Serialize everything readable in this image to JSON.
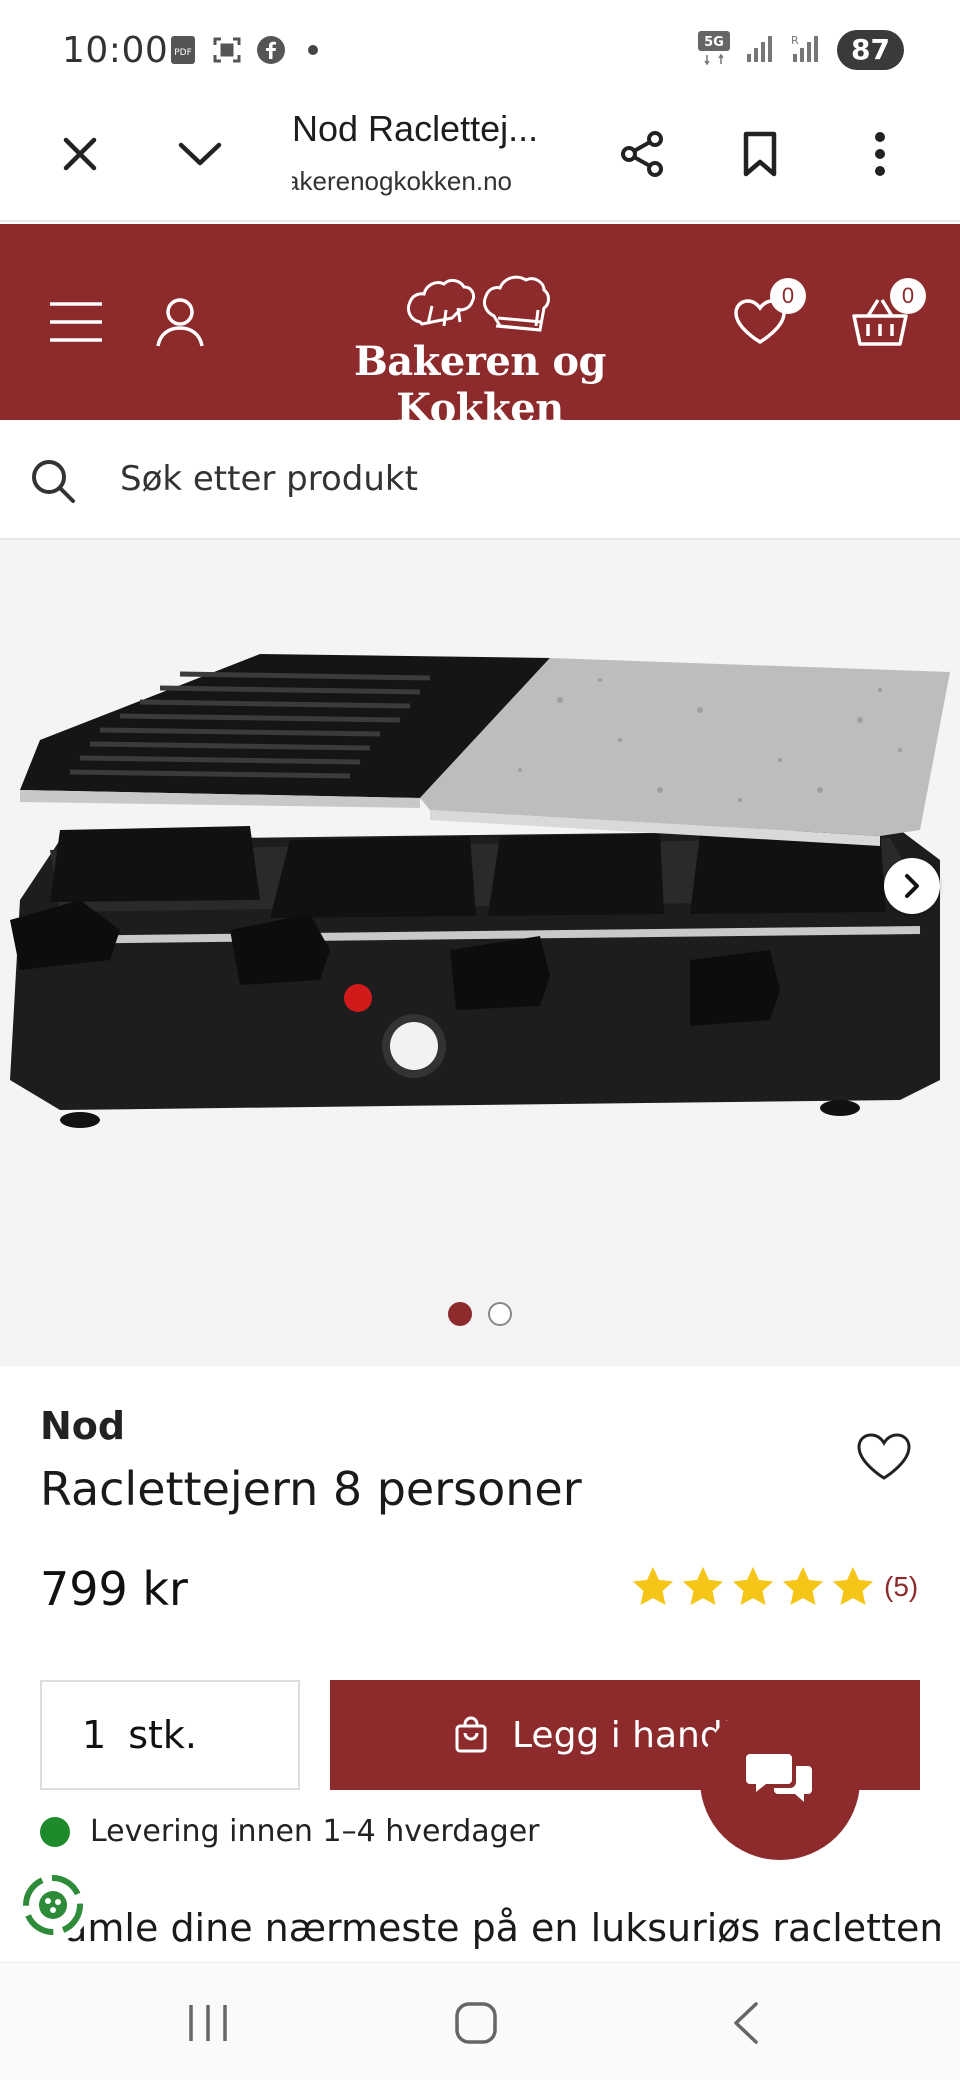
{
  "status_bar": {
    "time": "10:00",
    "battery": "87",
    "network": "5G",
    "icons": [
      "pdf-icon",
      "screenshot-icon",
      "facebook-icon",
      "notification-dot-icon",
      "signal-icon",
      "signal-icon-2"
    ]
  },
  "browser": {
    "tab_title": "Nod Raclettej...",
    "host": "bakerenogkokken.no",
    "icons": [
      "close-icon",
      "chevron-down-icon",
      "share-icon",
      "bookmark-icon",
      "more-vert-icon"
    ]
  },
  "site": {
    "logo_text": "Bakeren og Kokken",
    "wishlist_count": "0",
    "cart_count": "0",
    "brand_color": "#8c2a2c"
  },
  "search": {
    "placeholder": "Søk etter produkt"
  },
  "gallery": {
    "slide_count": 2,
    "active_slide": 1
  },
  "product": {
    "brand": "Nod",
    "title": "Raclettejern 8 personer",
    "price": "799 kr",
    "rating": 5,
    "review_count": "(5)",
    "quantity": "1",
    "unit": "stk.",
    "add_to_cart": "Legg i handlekurv",
    "delivery": "Levering innen 1–4 hverdager",
    "description_start": "Samle dine nærmeste på en luksuriøs raclettemiddag",
    "star_color": "#f5c518",
    "delivery_color": "#1f8a2c"
  }
}
